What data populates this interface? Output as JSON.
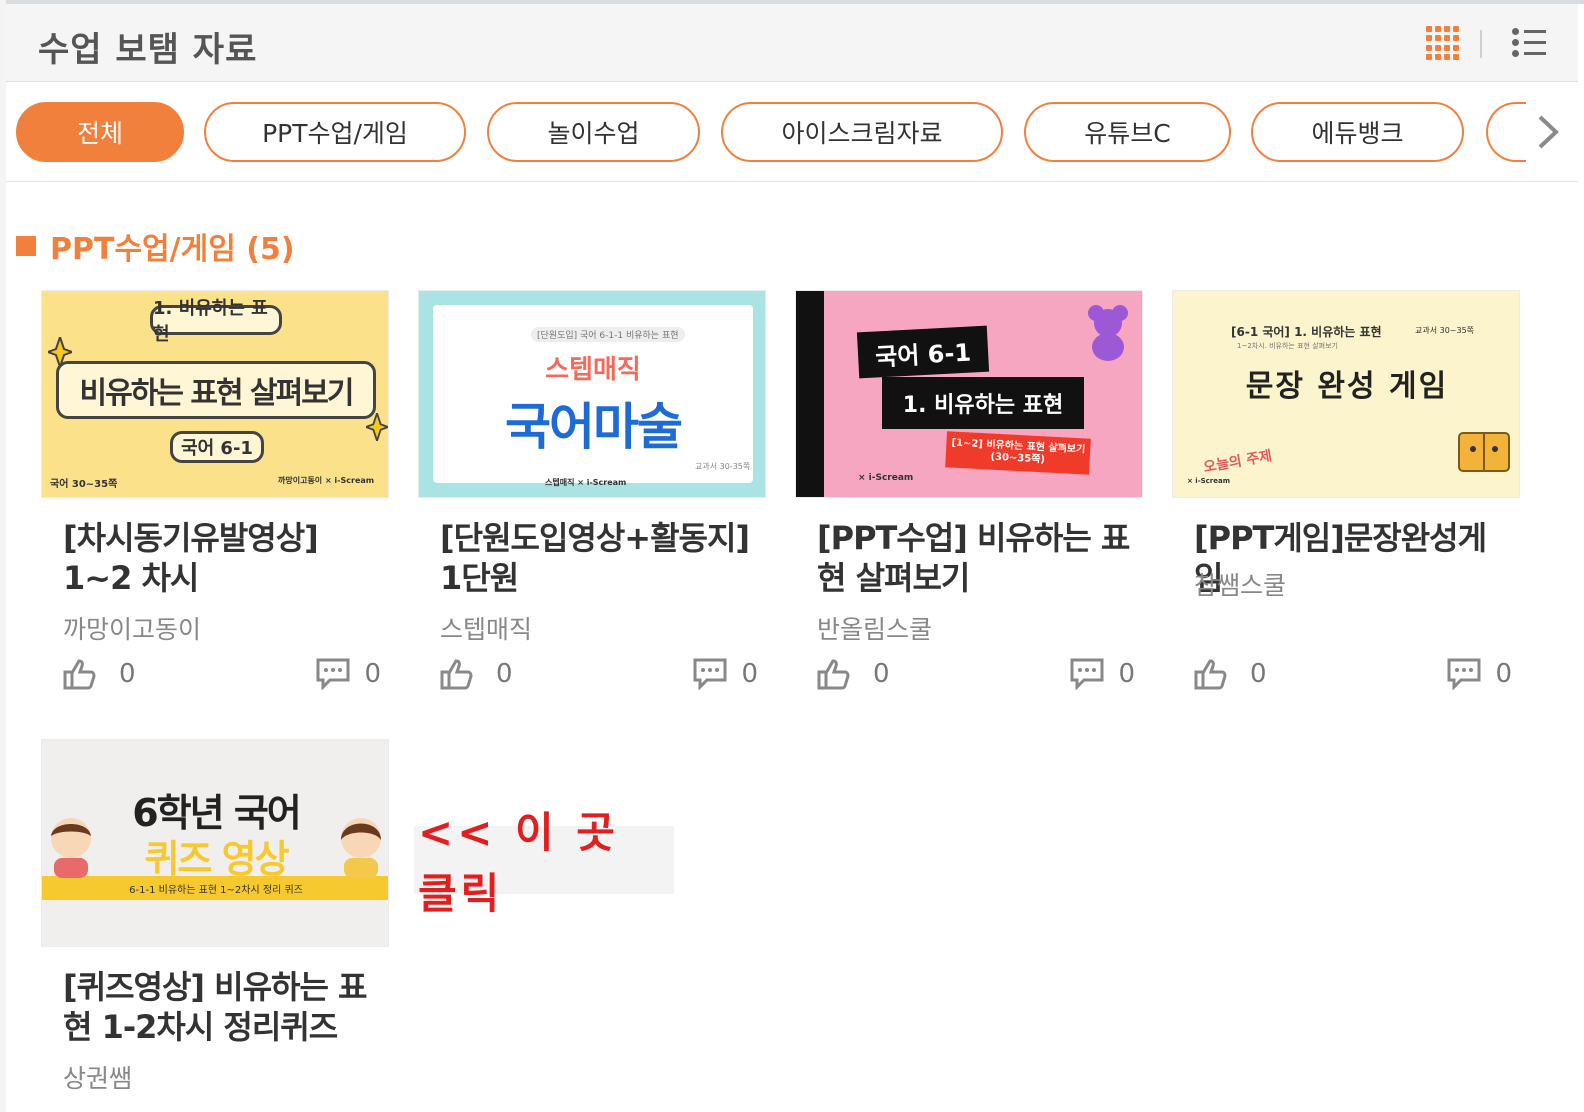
{
  "header": {
    "title": "수업 보탬 자료"
  },
  "tabs": [
    {
      "label": "전체",
      "active": true
    },
    {
      "label": "PPT수업/게임",
      "active": false
    },
    {
      "label": "놀이수업",
      "active": false
    },
    {
      "label": "아이스크림자료",
      "active": false
    },
    {
      "label": "유튜브C",
      "active": false
    },
    {
      "label": "에듀뱅크",
      "active": false
    }
  ],
  "section": {
    "title": "PPT수업/게임 (5)"
  },
  "cards": [
    {
      "title": "[차시동기유발영상] 1~2 차시",
      "author": "까망이고동이",
      "likes": "0",
      "comments": "0",
      "thumb": {
        "top_pill": "1. 비유하는 표현",
        "main": "비유하는 표현 살펴보기",
        "bottom_pill": "국어 6-1",
        "corner_left": "국어 30~35쪽",
        "corner_right": "까망이고동이 × i-Scream"
      }
    },
    {
      "title": "[단원도입영상+활동지] 1단원",
      "author": "스텝매직",
      "likes": "0",
      "comments": "0",
      "thumb": {
        "sub": "[단원도입] 국어 6-1-1 비유하는 표현",
        "brand": "스텝매직",
        "main": "국어마술",
        "page": "교과서 30-35쪽",
        "footer": "스텝매직 × i-Scream"
      }
    },
    {
      "title": "[PPT수업] 비유하는 표현 살펴보기",
      "author": "반올림스쿨",
      "likes": "0",
      "comments": "0",
      "thumb": {
        "line1": "국어 6-1",
        "line2": "1. 비유하는 표현",
        "tag": "[1~2] 비유하는 표현 살펴보기 (30~35쪽)",
        "footer": "× i-Scream"
      }
    },
    {
      "title": "[PPT게임]문장완성게임",
      "author": "참쌤스쿨",
      "likes": "0",
      "comments": "0",
      "thumb": {
        "head": "[6-1 국어] 1. 비유하는 표현",
        "page": "교과서 30~35쪽",
        "sub": "1~2차시. 비유하는 표현 살펴보기",
        "main": "문장 완성 게임",
        "deco": "오늘의 주제",
        "footer": "× i-Scream"
      }
    },
    {
      "title": "[퀴즈영상] 비유하는 표현 1-2차시 정리퀴즈",
      "author": "상권쌤",
      "likes": "",
      "comments": "",
      "thumb": {
        "line1": "6학년 국어",
        "line2": "퀴즈 영상",
        "band": "6-1-1 비유하는 표현 1~2차시 정리 퀴즈"
      }
    }
  ],
  "note": {
    "text": "<< 이 곳 클릭"
  },
  "colors": {
    "accent": "#f2803d",
    "note": "#e02020"
  },
  "icons": [
    "grid-view-icon",
    "list-view-icon",
    "chevron-right-icon",
    "thumbs-up-icon",
    "comment-icon"
  ]
}
